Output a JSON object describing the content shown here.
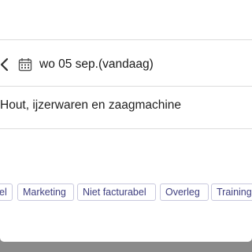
{
  "date_row": {
    "back_icon": "chevron-left-icon",
    "calendar_icon": "calendar-icon",
    "date_label": "wo 05 sep.(vandaag)"
  },
  "description": {
    "text": "Hout, ijzerwaren en zaagmachine"
  },
  "tags": [
    "el",
    "Marketing",
    "Niet facturabel",
    "Overleg",
    "Training"
  ],
  "colors": {
    "backdrop": "#8a8a8a",
    "card": "#ffffff",
    "tag_border": "#c9c9de",
    "tag_text": "#3f3f80",
    "divider": "#dcdcdc"
  }
}
